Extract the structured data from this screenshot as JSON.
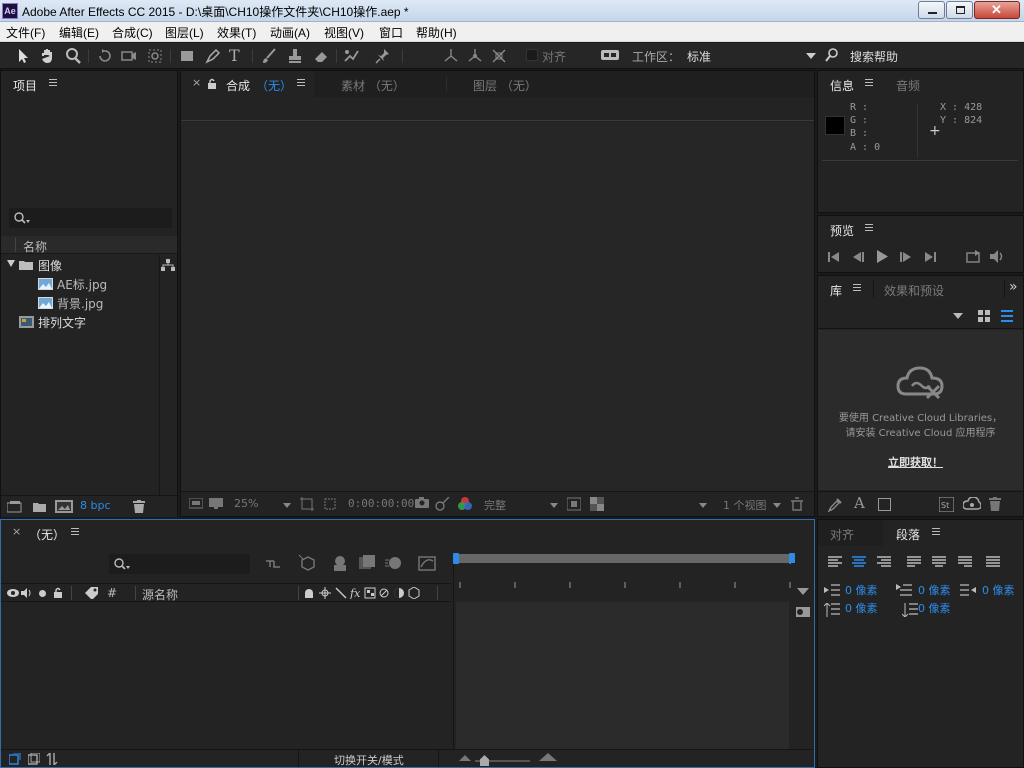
{
  "titlebar": {
    "logo": "Ae",
    "title": "Adobe After Effects CC 2015 - D:\\桌面\\CH10操作文件夹\\CH10操作.aep *"
  },
  "menu": [
    {
      "label": "文件(F)"
    },
    {
      "label": "编辑(E)"
    },
    {
      "label": "合成(C)"
    },
    {
      "label": "图层(L)"
    },
    {
      "label": "效果(T)"
    },
    {
      "label": "动画(A)"
    },
    {
      "label": "视图(V)"
    },
    {
      "label": "窗口"
    },
    {
      "label": "帮助(H)"
    }
  ],
  "toolbar": {
    "snap_label": "对齐",
    "workspace_label": "工作区：",
    "workspace_value": "标准",
    "search_help": "搜索帮助"
  },
  "project": {
    "tab": "项目",
    "column_name": "名称",
    "items": [
      {
        "name": "图像",
        "type": "folder"
      },
      {
        "name": "AE标.jpg",
        "type": "image"
      },
      {
        "name": "背景.jpg",
        "type": "image"
      },
      {
        "name": "排列文字",
        "type": "composition"
      }
    ],
    "bpc": "8 bpc"
  },
  "viewer": {
    "tab_comp": "合成",
    "tab_comp_value": "（无）",
    "tab_footage": "素材 （无）",
    "tab_layer": "图层 （无）",
    "zoom": "25%",
    "timecode": "0:00:00:00",
    "resolution": "完整",
    "views": "1 个视图"
  },
  "info": {
    "tab_info": "信息",
    "tab_audio": "音频",
    "r_label": "R :",
    "g_label": "G :",
    "b_label": "B :",
    "a_label": "A : 0",
    "x_label": "X : 428",
    "y_label": "Y : 824"
  },
  "preview": {
    "tab": "预览"
  },
  "library": {
    "tab_library": "库",
    "tab_effects": "效果和预设",
    "message_line1": "要使用 Creative Cloud Libraries，",
    "message_line2": "请安装 Creative Cloud 应用程序",
    "get_now": "立即获取！"
  },
  "timeline": {
    "tab": "（无）",
    "col_hash": "#",
    "col_source": "源名称",
    "toggle_modes": "切换开关/模式"
  },
  "paragraph": {
    "tab_align": "对齐",
    "tab_paragraph": "段落",
    "indent_left": "0 像素",
    "indent_first": "0 像素",
    "indent_right": "0 像素",
    "space_before": "0 像素",
    "space_after": "0 像素"
  },
  "colors": {
    "accent_blue": "#2d8ceb",
    "panel_bg": "#232323",
    "title_bar": "#c4d5ea"
  }
}
